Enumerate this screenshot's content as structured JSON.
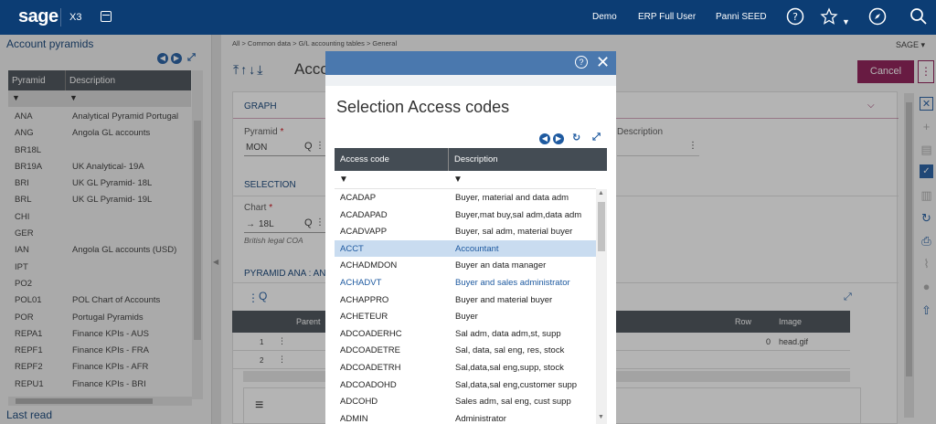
{
  "topbar": {
    "logo": "sage",
    "product": "X3",
    "links": [
      "Demo",
      "ERP Full User",
      "Panni SEED"
    ]
  },
  "left_panel": {
    "title": "Account pyramids",
    "columns": [
      "Pyramid",
      "Description"
    ],
    "rows": [
      {
        "code": "ANA",
        "desc": "Analytical Pyramid Portugal"
      },
      {
        "code": "ANG",
        "desc": "Angola GL accounts"
      },
      {
        "code": "BR18L",
        "desc": ""
      },
      {
        "code": "BR19A",
        "desc": "UK Analytical- 19A"
      },
      {
        "code": "BRI",
        "desc": "UK GL Pyramid- 18L"
      },
      {
        "code": "BRL",
        "desc": "UK GL Pyramid- 19L"
      },
      {
        "code": "CHI",
        "desc": ""
      },
      {
        "code": "GER",
        "desc": ""
      },
      {
        "code": "IAN",
        "desc": "Angola GL accounts (USD)"
      },
      {
        "code": "IPT",
        "desc": ""
      },
      {
        "code": "PO2",
        "desc": ""
      },
      {
        "code": "POL01",
        "desc": "POL Chart of Accounts"
      },
      {
        "code": "POR",
        "desc": "Portugal Pyramids"
      },
      {
        "code": "REPA1",
        "desc": "Finance KPIs - AUS"
      },
      {
        "code": "REPF1",
        "desc": "Finance KPIs - FRA"
      },
      {
        "code": "REPF2",
        "desc": "Finance KPIs - AFR"
      },
      {
        "code": "REPU1",
        "desc": "Finance KPIs - BRI"
      }
    ],
    "footer": "Last read"
  },
  "main": {
    "breadcrumb": [
      "All",
      "Common data",
      "G/L accounting tables",
      "General"
    ],
    "company": "SAGE",
    "title": "Acco",
    "cancel_label": "Cancel",
    "sections": {
      "graph": "GRAPH",
      "selection": "SELECTION",
      "pyramid_ana": "PYRAMID ANA : AN"
    },
    "pyramid_label": "Pyramid",
    "pyramid_value": "MON",
    "description_label": "Description",
    "chart_label": "Chart",
    "chart_value": "18L",
    "chart_subtext": "British legal COA",
    "grid_columns": [
      "Parent",
      "Row",
      "Image"
    ],
    "grid_rows": [
      {
        "num": "1",
        "row": "0",
        "image": "head.gif"
      },
      {
        "num": "2",
        "row": "",
        "image": ""
      }
    ]
  },
  "modal": {
    "title": "Selection Access codes",
    "columns": [
      "Access code",
      "Description"
    ],
    "selected_index": 3,
    "highlight_index": 5,
    "rows": [
      {
        "code": "ACADAP",
        "desc": "Buyer, material and data adm"
      },
      {
        "code": "ACADAPAD",
        "desc": "Buyer,mat buy,sal adm,data adm"
      },
      {
        "code": "ACADVAPP",
        "desc": "Buyer, sal adm, material buyer"
      },
      {
        "code": "ACCT",
        "desc": "Accountant"
      },
      {
        "code": "ACHADMDON",
        "desc": "Buyer an data manager"
      },
      {
        "code": "ACHADVT",
        "desc": "Buyer and sales administrator"
      },
      {
        "code": "ACHAPPRO",
        "desc": "Buyer and material buyer"
      },
      {
        "code": "ACHETEUR",
        "desc": "Buyer"
      },
      {
        "code": "ADCOADERHC",
        "desc": "Sal adm, data adm,st, supp"
      },
      {
        "code": "ADCOADETRE",
        "desc": "Sal, data, sal eng, res, stock"
      },
      {
        "code": "ADCOADETRH",
        "desc": "Sal,data,sal eng,supp, stock"
      },
      {
        "code": "ADCOADOHD",
        "desc": "Sal,data,sal eng,customer supp"
      },
      {
        "code": "ADCOHD",
        "desc": "Sales adm, sal eng, cust supp"
      },
      {
        "code": "ADMIN",
        "desc": "Administrator"
      }
    ]
  }
}
